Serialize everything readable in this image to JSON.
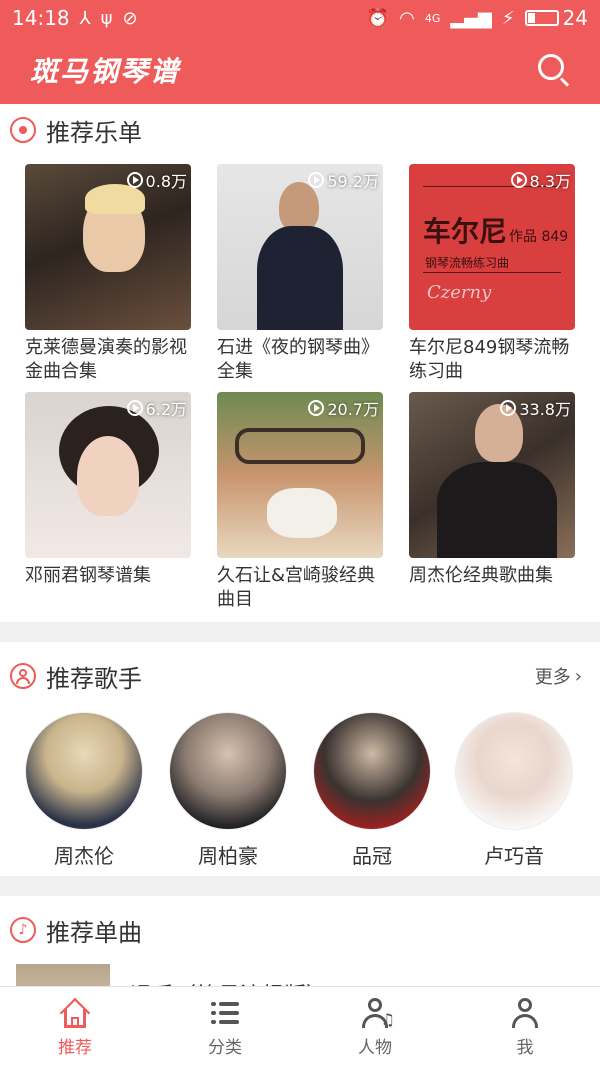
{
  "status_bar": {
    "time": "14:18",
    "left_icons": [
      "usb-debug-icon",
      "usb-icon",
      "sync-icon"
    ],
    "right_icons": [
      "alarm-icon",
      "wifi-icon",
      "signal-4g-icon",
      "charging-icon"
    ],
    "network_label": "4G",
    "battery_percent": 24
  },
  "header": {
    "app_title": "斑马钢琴谱",
    "search_icon": "search-icon"
  },
  "recommended_playlists": {
    "title": "推荐乐单",
    "icon": "disc-icon",
    "items": [
      {
        "title": "克莱德曼演奏的影视金曲合集",
        "play_count": "0.8万"
      },
      {
        "title": "石进《夜的钢琴曲》全集",
        "play_count": "59.2万"
      },
      {
        "title": "车尔尼849钢琴流畅练习曲",
        "play_count": "8.3万",
        "cover_text": {
          "main": "车尔尼",
          "sub": "作品 849",
          "caption": "钢琴流畅练习曲",
          "signature": "Czerny"
        }
      },
      {
        "title": "邓丽君钢琴谱集",
        "play_count": "6.2万"
      },
      {
        "title": "久石让&宫崎骏经典曲目",
        "play_count": "20.7万"
      },
      {
        "title": "周杰伦经典歌曲集",
        "play_count": "33.8万"
      }
    ]
  },
  "recommended_singers": {
    "title": "推荐歌手",
    "icon": "person-icon",
    "more_label": "更多",
    "items": [
      {
        "name": "周杰伦"
      },
      {
        "name": "周柏豪"
      },
      {
        "name": "品冠"
      },
      {
        "name": "卢巧音"
      }
    ]
  },
  "recommended_singles": {
    "title": "推荐单曲",
    "icon": "music-note-icon",
    "first_item_title": "退后（简易流畅版）"
  },
  "tab_bar": {
    "tabs": [
      {
        "label": "推荐",
        "icon": "home-icon",
        "active": true
      },
      {
        "label": "分类",
        "icon": "list-icon",
        "active": false
      },
      {
        "label": "人物",
        "icon": "person-music-icon",
        "active": false
      },
      {
        "label": "我",
        "icon": "user-icon",
        "active": false
      }
    ]
  },
  "colors": {
    "accent": "#ef5b5b",
    "divider": "#f0f0f0"
  }
}
